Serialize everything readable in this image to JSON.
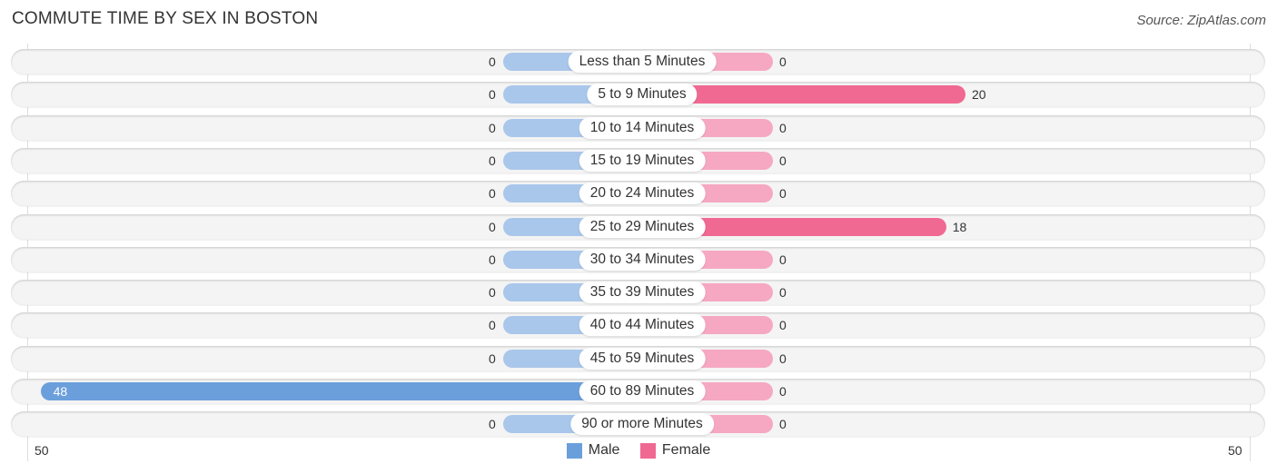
{
  "header": {
    "title": "COMMUTE TIME BY SEX IN BOSTON",
    "source": "Source: ZipAtlas.com"
  },
  "colors": {
    "male": "#6a9fdc",
    "male_light": "#a9c7ea",
    "female": "#f06992",
    "female_light": "#f6a8c2"
  },
  "chart_data": {
    "type": "bar",
    "orientation": "horizontal-diverging",
    "title": "COMMUTE TIME BY SEX IN BOSTON",
    "categories": [
      "Less than 5 Minutes",
      "5 to 9 Minutes",
      "10 to 14 Minutes",
      "15 to 19 Minutes",
      "20 to 24 Minutes",
      "25 to 29 Minutes",
      "30 to 34 Minutes",
      "35 to 39 Minutes",
      "40 to 44 Minutes",
      "45 to 59 Minutes",
      "60 to 89 Minutes",
      "90 or more Minutes"
    ],
    "series": [
      {
        "name": "Male",
        "values": [
          0,
          0,
          0,
          0,
          0,
          0,
          0,
          0,
          0,
          0,
          48,
          0
        ]
      },
      {
        "name": "Female",
        "values": [
          0,
          20,
          0,
          0,
          0,
          18,
          0,
          0,
          0,
          0,
          0,
          0
        ]
      }
    ],
    "axis": {
      "left_tick": "50",
      "right_tick": "50",
      "range": [
        0,
        50
      ]
    },
    "legend": [
      "Male",
      "Female"
    ],
    "legend_position": "bottom-center"
  }
}
